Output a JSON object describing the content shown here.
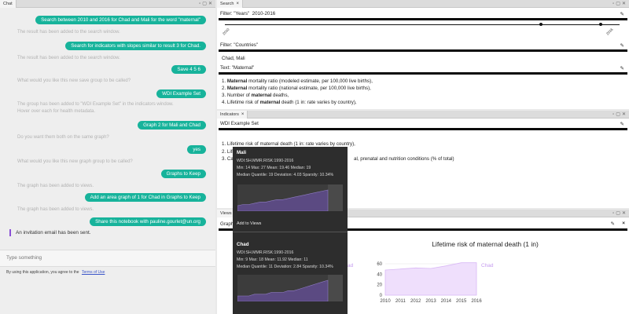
{
  "chat": {
    "tab_label": "Chat",
    "close_glyph": "×",
    "messages": [
      {
        "role": "user",
        "text": "Search between 2010 and 2016 for Chad and Mali for the word \"maternal\""
      },
      {
        "role": "bot",
        "text": "The result has been added to the search window."
      },
      {
        "role": "user",
        "text": "Search for indicators with slopes similar to result 3 for Chad."
      },
      {
        "role": "bot",
        "text": "The result has been added to the search window."
      },
      {
        "role": "user",
        "text": "Save 4 5 6"
      },
      {
        "role": "bot",
        "text": "What would you like this new save group to be called?"
      },
      {
        "role": "user",
        "text": "WDI Example Set"
      },
      {
        "role": "bot",
        "text": "The group has been added to \"WDI Example Set\" in the indicators window."
      },
      {
        "role": "bot",
        "text": "Hover over each for health metadata."
      },
      {
        "role": "user",
        "text": "Graph 2 for Mali and Chad"
      },
      {
        "role": "bot",
        "text": "Do you want them both on the same graph?"
      },
      {
        "role": "user",
        "text": "yes"
      },
      {
        "role": "bot",
        "text": "What would you like this new graph group to be called?"
      },
      {
        "role": "user",
        "text": "Graphs to Keep"
      },
      {
        "role": "bot",
        "text": "The graph has been added to views."
      },
      {
        "role": "user",
        "text": "Add an area graph of 1 for Chad in Graphs to Keep"
      },
      {
        "role": "bot",
        "text": "The graph has been added to views."
      },
      {
        "role": "user",
        "text": "Share this notebook with pauline.gourlet@un.org"
      }
    ],
    "invite_text": "An invitation email has been sent.",
    "input_placeholder": "Type something",
    "terms_prefix": "By using this application, you agree to the",
    "terms_link": "Terms of Use"
  },
  "search": {
    "tab_label": "Search",
    "filter_years_label": "Filter: \"Years\"",
    "filter_years_value": "2010-2016",
    "slider_min": "2010",
    "slider_max": "2016",
    "filter_countries_label": "Filter: \"Countries\"",
    "countries_value": "Chad, Mali",
    "text_label": "Text: \"Maternal\"",
    "results": [
      {
        "prefix": "1. ",
        "bold": "Maternal",
        "rest": " mortality ratio (modeled estimate, per 100,000 live births),"
      },
      {
        "prefix": "2. ",
        "bold": "Maternal",
        "rest": " mortality ratio (national estimate, per 100,000 live births),"
      },
      {
        "prefix": "3. Number of ",
        "bold": "maternal",
        "rest": " deaths,"
      },
      {
        "prefix": "4. Lifetime risk of ",
        "bold": "maternal",
        "rest": " death (1 in: rate varies by country),"
      }
    ]
  },
  "indicators": {
    "tab_label": "Indicators",
    "set_name": "WDI Example Set",
    "items": [
      "1. Lifetime risk of maternal death (1 in: rate varies by country),",
      "2. Lifi",
      "3. Ca"
    ],
    "item3_tail": "al, prenatal and nutrition conditions (% of total)"
  },
  "views": {
    "tab_label": "Views",
    "group_label": "Graph",
    "chart_title": "Lifetime risk of maternal death (1 in)",
    "legend_chad": "Chad",
    "legend_mali_fragment": "ad"
  },
  "tooltip": {
    "mali": {
      "title": "Mali",
      "code": "WDI:SH.MMR.RISK:1990-2016",
      "stats1": "Min: 14 Max: 27 Mean: 19.46 Median: 19",
      "stats2": "Median Quantile: 19 Deviation: 4.03 Sparsity: 10.34%",
      "spark": [
        14,
        15,
        15,
        16,
        17,
        17,
        18,
        19,
        19,
        20,
        21,
        22,
        23,
        24,
        25,
        26,
        27
      ]
    },
    "add_label": "Add to Views",
    "chad": {
      "title": "Chad",
      "code": "WDI:SH.MMR.RISK:1990-2016",
      "stats1": "Min: 9 Max: 18 Mean: 11.92 Median: 11",
      "stats2": "Median Quantile: 11 Deviation: 2.84 Sparsity: 10.34%",
      "spark": [
        9,
        9,
        9,
        10,
        10,
        10,
        11,
        11,
        11,
        12,
        12,
        13,
        14,
        15,
        16,
        17,
        18
      ]
    }
  },
  "chart_data": {
    "type": "area",
    "title": "Lifetime risk of maternal death (1 in)",
    "x": [
      2010,
      2011,
      2012,
      2013,
      2014,
      2015,
      2016
    ],
    "ylim": [
      0,
      60
    ],
    "yticks": [
      0,
      20,
      40,
      60
    ],
    "series": [
      {
        "name": "Chad",
        "values": [
          48,
          50,
          52,
          51,
          56,
          62,
          62
        ]
      }
    ],
    "color": "#d9b8f5"
  }
}
